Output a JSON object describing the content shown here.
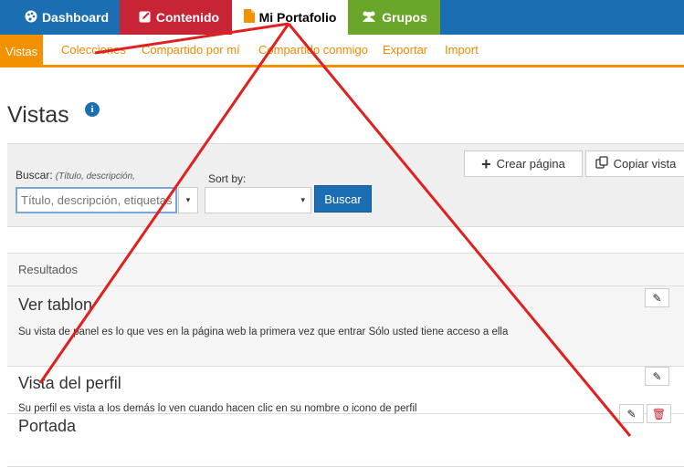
{
  "topnav": {
    "tabs": [
      {
        "label": "Dashboard",
        "icon": "palette-icon"
      },
      {
        "label": "Contenido",
        "icon": "pencil-square-icon"
      },
      {
        "label": "Mi Portafolio",
        "icon": "file-icon"
      },
      {
        "label": "Grupos",
        "icon": "users-icon"
      }
    ]
  },
  "subnav": {
    "items": [
      "Vistas",
      "Colecciones",
      "Compartido por mí",
      "Compartido conmigo",
      "Exportar",
      "Import"
    ],
    "active": "Vistas"
  },
  "page": {
    "title": "Vistas",
    "info_icon": "i"
  },
  "search": {
    "label": "Buscar:",
    "hint": "(Título, descripción,",
    "placeholder": "Título, descripción, etiquetas",
    "sort_label": "Sort by:",
    "sort_value": "",
    "button": "Buscar"
  },
  "actions": {
    "create": "Crear página",
    "copy": "Copiar vista"
  },
  "results": {
    "heading": "Resultados",
    "items": [
      {
        "title": "Ver tablon",
        "description": "Su vista de panel es lo que ves en la página web la primera vez que entrar Sólo usted tiene acceso a ella"
      },
      {
        "title": "Vista del perfil",
        "description": "Su perfil es vista a los demás lo ven cuando hacen clic en su nombre o icono de perfil"
      },
      {
        "title": "Portada",
        "description": ""
      }
    ]
  },
  "colors": {
    "dashboard": "#1c6eb3",
    "contenido": "#c72435",
    "grupos": "#6aa62a",
    "accent": "#f39200",
    "annotation": "#e0201e"
  }
}
